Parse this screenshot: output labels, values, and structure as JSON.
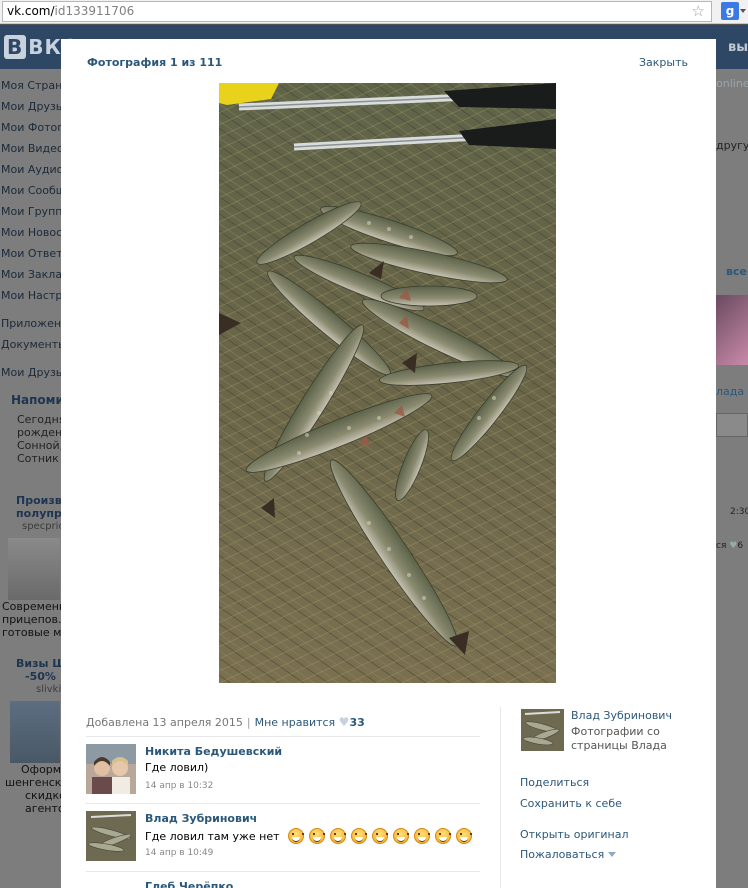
{
  "browser": {
    "url_host": "vk.com/",
    "url_path": "id133911706"
  },
  "vk_bg": {
    "logo": "ВКОН",
    "header_right": "вы",
    "menu": [
      "Моя Страни",
      "Мои Друзья",
      "Мои Фотогр",
      "Мои Видеоз",
      "Мои Аудиоз",
      "Мои Сообщ",
      "Мои Группы",
      "Мои Новост",
      "Мои Ответы",
      "Мои Заклад",
      "Мои Настро"
    ],
    "menu2": [
      "Приложения",
      "Документы"
    ],
    "menu3": [
      "Мои Друзья"
    ],
    "reminder_title": "Напомин",
    "reminder_lines": [
      "Сегодня",
      "рождени",
      "Сонной, ",
      "Сотник"
    ],
    "ad1_title": [
      "Произво",
      "полупри"
    ],
    "ad1_small": "specpric",
    "ad1_lines": [
      "Современны",
      "прицепов. С",
      "готовые м"
    ],
    "ad2_title": [
      "Визы Ше",
      "-50%"
    ],
    "ad2_small": "slivki.",
    "ad2_lines": [
      "Оформл",
      "шенгенских",
      "скидкой",
      "агентс"
    ],
    "right_col": [
      "online",
      "другу",
      "все",
      "лада",
      "2:30",
      "ся ",
      "6"
    ]
  },
  "modal": {
    "title": "Фотография 1 из 111",
    "close": "Закрыть",
    "added": "Добавлена 13 апреля 2015",
    "sep": "|",
    "like_label": "Мне нравится",
    "like_count": "33",
    "comments": [
      {
        "name": "Никита Бедушевский",
        "text": "Где ловил)",
        "time": "14 апр в 10:32"
      },
      {
        "name": "Влад Зубринович",
        "text": "Где ловил там уже нет",
        "time": "14 апр в 10:49"
      },
      {
        "name": "Глеб Черёпко",
        "text": "",
        "time": ""
      }
    ],
    "owner_name": "Влад Зубринович",
    "owner_desc": "Фотографии со страницы Влада",
    "actions": [
      "Поделиться",
      "Сохранить к себе",
      "Открыть оригинал",
      "Пожаловаться"
    ]
  },
  "colors": {
    "link": "#2b587a",
    "vk_header": "#2e4764",
    "overlay": "#525252"
  },
  "icons": [
    "star-icon",
    "google-search-icon",
    "heart-icon",
    "smile-icon",
    "dropdown-triangle-icon"
  ]
}
